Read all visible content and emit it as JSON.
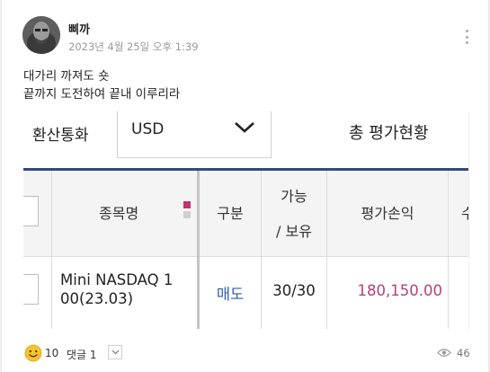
{
  "post": {
    "author": "삐까",
    "date": "2023년 4월 25일 오후 1:39",
    "text_lines": [
      "대가리 까져도 숏",
      "끝까지 도전하여 끝내 이루리라"
    ]
  },
  "screenshot": {
    "currency_label": "환산통화",
    "currency_value": "USD",
    "total_label": "총 평가현황",
    "columns": {
      "name": "종목명",
      "type": "구분",
      "qty_line1": "가능",
      "qty_line2": "/ 보유",
      "pnl": "평가손익",
      "partial": "수"
    },
    "row": {
      "name_line1": "Mini NASDAQ 1",
      "name_line2": "00(23.03)",
      "type": "매도",
      "qty": "30/30",
      "pnl": "180,150.00"
    },
    "colors": {
      "header_bar": "#2f4d7a",
      "sell": "#2e5fa8",
      "pnl": "#b0427e"
    }
  },
  "footer": {
    "reaction_icon": "smile-emoji-icon",
    "reaction_count": "10",
    "comment_label": "댓글 1",
    "view_count": "46"
  }
}
